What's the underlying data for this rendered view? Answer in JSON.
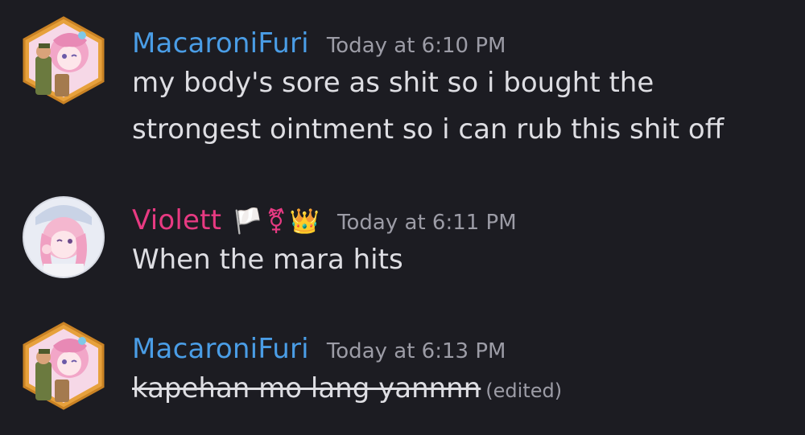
{
  "colors": {
    "background": "#1c1c22",
    "username_blue": "#4a9de6",
    "username_pink": "#e73a82",
    "timestamp": "#9c9ca6",
    "message_text": "#dedee3"
  },
  "messages": [
    {
      "username": "MacaroniFuri",
      "timestamp": "Today at 6:10 PM",
      "lines": [
        "my body's sore as shit so i bought the",
        "strongest ointment so i can rub this shit off"
      ],
      "avatar_icon": "anime-avatar-hexagon-frame"
    },
    {
      "username": "Violett",
      "badges": [
        "🏳️",
        "⚧",
        "👑"
      ],
      "timestamp": "Today at 6:11 PM",
      "lines": [
        "When the mara hits"
      ],
      "avatar_icon": "anime-avatar-circle"
    },
    {
      "username": "MacaroniFuri",
      "timestamp": "Today at 6:13 PM",
      "lines": [
        "kapehan mo lang yannnn"
      ],
      "edited_label": "(edited)",
      "avatar_icon": "anime-avatar-hexagon-frame"
    }
  ]
}
